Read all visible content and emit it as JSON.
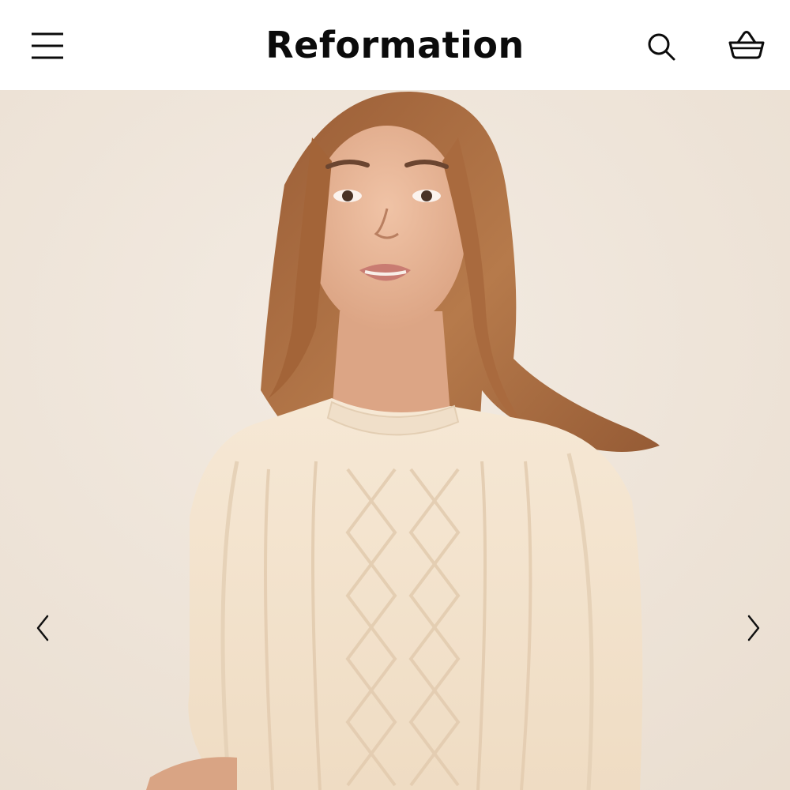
{
  "header": {
    "brand": "Reformation",
    "icons": {
      "menu": "hamburger-menu-icon",
      "search": "search-icon",
      "cart": "shopping-basket-icon"
    }
  },
  "carousel": {
    "image": "woman-in-cream-cable-knit-sweater",
    "prev_icon": "chevron-left-icon",
    "next_icon": "chevron-right-icon"
  },
  "colors": {
    "header_bg": "#ffffff",
    "text": "#0b0b0b",
    "backdrop": "#efe5da",
    "sweater": "#f3e3ce",
    "hair": "#a8673d",
    "skin": "#e6b496"
  }
}
